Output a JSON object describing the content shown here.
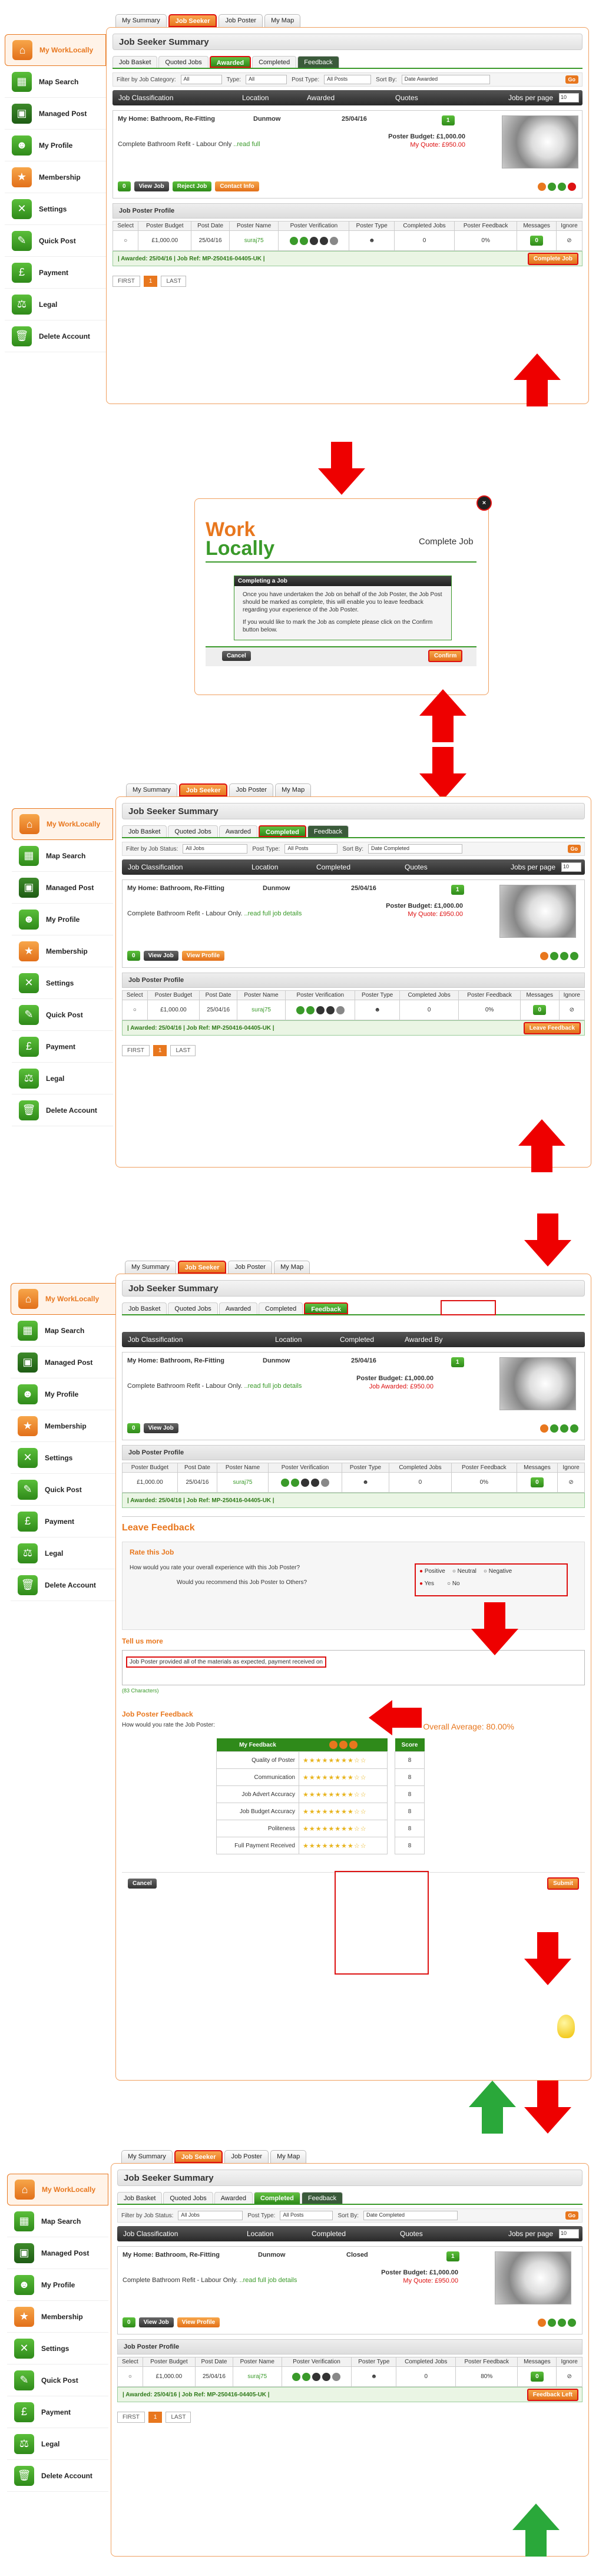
{
  "top_tabs": [
    "My Summary",
    "Job Seeker",
    "Job Poster",
    "My Map"
  ],
  "sidebar": [
    {
      "label": "My WorkLocally",
      "icon": "house-icon"
    },
    {
      "label": "Map Search",
      "icon": "map-icon"
    },
    {
      "label": "Managed Post",
      "icon": "briefcase-icon"
    },
    {
      "label": "My Profile",
      "icon": "person-icon"
    },
    {
      "label": "Membership",
      "icon": "badge-icon"
    },
    {
      "label": "Settings",
      "icon": "tools-icon"
    },
    {
      "label": "Quick Post",
      "icon": "quick-post-icon"
    },
    {
      "label": "Payment",
      "icon": "payment-icon"
    },
    {
      "label": "Legal",
      "icon": "gavel-icon"
    },
    {
      "label": "Delete Account",
      "icon": "trash-icon"
    }
  ],
  "summary_title": "Job Seeker Summary",
  "sub_tabs": [
    "Job Basket",
    "Quoted Jobs",
    "Awarded",
    "Completed",
    "Feedback"
  ],
  "filters": {
    "job_category_label": "Filter by Job Category:",
    "job_category": "All",
    "type_label": "Type:",
    "type": "All",
    "post_type_label": "Post Type:",
    "post_type": "All Posts",
    "sort_label": "Sort By:",
    "sort": "Date Awarded",
    "sort_completed": "Date Completed",
    "job_status_label": "Filter by Job Status:",
    "job_status": "All Jobs",
    "go": "Go"
  },
  "columns": {
    "classification": "Job Classification",
    "location": "Location",
    "awarded": "Awarded",
    "quotes": "Quotes",
    "completed": "Completed",
    "awarded_by": "Awarded By",
    "per_page": "Jobs per page",
    "per_page_val": "10"
  },
  "job": {
    "title": "My Home: Bathroom, Re-Fitting",
    "location": "Dunmow",
    "date": "25/04/16",
    "status_closed": "Closed",
    "quotes_count": "1",
    "desc": "Complete Bathroom Refit - Labour Only",
    "desc_short": "Complete Bathroom Refit - Labour Only.",
    "read_full": "..read full",
    "read_full_details": "..read full job details",
    "budget_label": "Poster Budget:",
    "budget": "£1,000.00",
    "quote_label": "My Quote:",
    "quote": "£950.00",
    "job_awarded_label": "Job Awarded:",
    "msg_count": "0"
  },
  "buttons": {
    "view_job": "View Job",
    "reject_job": "Reject Job",
    "contact_info": "Contact Info",
    "view_profile": "View Profile",
    "complete_job": "Complete Job",
    "leave_feedback": "Leave Feedback",
    "feedback_left": "Feedback Left",
    "cancel": "Cancel",
    "confirm": "Confirm",
    "submit": "Submit"
  },
  "profile": {
    "title": "Job Poster Profile",
    "headers": [
      "Select",
      "Poster Budget",
      "Post Date",
      "Poster Name",
      "Poster Verification",
      "Poster Type",
      "Completed Jobs",
      "Poster Feedback",
      "Messages",
      "Ignore"
    ],
    "budget": "£1,000.00",
    "post_date": "25/04/16",
    "name": "suraj75",
    "completed": "0",
    "feedback": "0%",
    "feedback_final": "80%",
    "messages": "0",
    "awarded_line": "| Awarded: 25/04/16 | Job Ref: MP-250416-04405-UK |"
  },
  "pager": [
    "FIRST",
    "1",
    "LAST"
  ],
  "modal": {
    "logo_top": "Work",
    "logo_bottom": "Locally",
    "title": "Complete Job",
    "box_title": "Completing a Job",
    "text1": "Once you have undertaken the Job on behalf of the Job Poster, the Job Post should be marked as complete, this will enable you to leave feedback regarding your experience of the Job Poster.",
    "text2": "If you would like to mark the Job as complete please click on the Confirm button below."
  },
  "feedback": {
    "heading": "Leave Feedback",
    "rate_title": "Rate this Job",
    "q1": "How would you rate your overall experience with this Job Poster?",
    "q2": "Would you recommend this Job Poster to Others?",
    "opt_positive": "Positive",
    "opt_neutral": "Neutral",
    "opt_negative": "Negative",
    "opt_yes": "Yes",
    "opt_no": "No",
    "tell_title": "Tell us more",
    "comment": "Job Poster provided all of the materials as expected, payment received on",
    "chars": "(83 Characters)",
    "poster_fb_title": "Job Poster Feedback",
    "poster_fb_q": "How would you rate the Job Poster:",
    "overall_label": "Overall Average:",
    "overall": "80.00%",
    "my_feedback": "My Feedback",
    "score": "Score",
    "criteria": [
      "Quality of Poster",
      "Communication",
      "Job Advert Accuracy",
      "Job Budget Accuracy",
      "Politeness",
      "Full Payment Received"
    ],
    "score_val": "8"
  },
  "colors": {
    "accent": "#e8771e",
    "green": "#3a9a2a",
    "red": "#dd1111"
  }
}
